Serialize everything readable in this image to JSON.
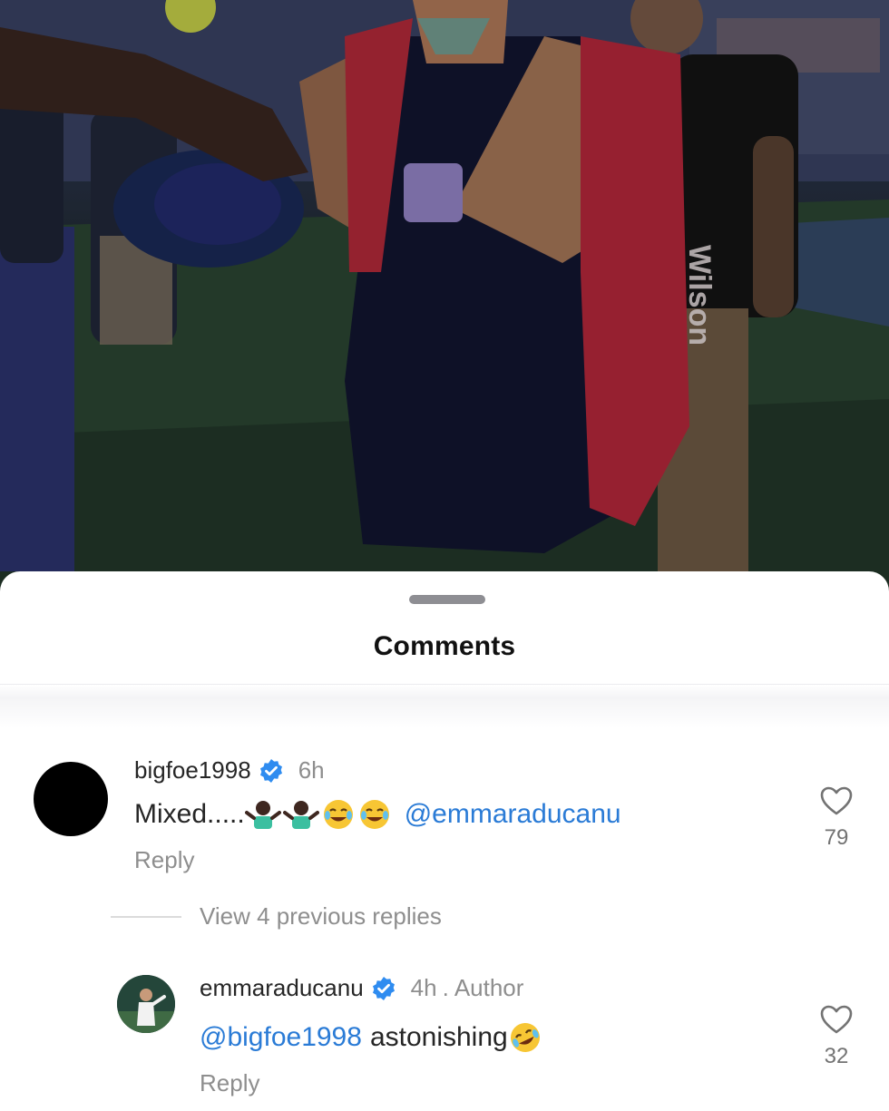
{
  "header": {
    "title": "Comments"
  },
  "photo": {
    "bag_brand": "Wilson"
  },
  "comments": [
    {
      "username": "bigfoe1998",
      "verified": true,
      "time": "6h",
      "text_prefix": "Mixed.....",
      "emojis": [
        "person-shrugging-emoji",
        "person-shrugging-emoji",
        "joy-emoji",
        "joy-emoji"
      ],
      "mention": "@emmaraducanu",
      "text_suffix": "",
      "reply_label": "Reply",
      "likes": "79"
    },
    {
      "username": "emmaraducanu",
      "verified": true,
      "time": "4h",
      "separator": ".",
      "tag": "Author",
      "mention": "@bigfoe1998",
      "text_suffix": "astonishing",
      "emojis": [
        "rolling-on-floor-laughing-emoji"
      ],
      "reply_label": "Reply",
      "likes": "32"
    }
  ],
  "thread": {
    "view_replies_label": "View 4 previous replies"
  },
  "colors": {
    "mention": "#2a7bd6",
    "verified": "#2f8cf0",
    "muted": "#8e8e8e"
  }
}
